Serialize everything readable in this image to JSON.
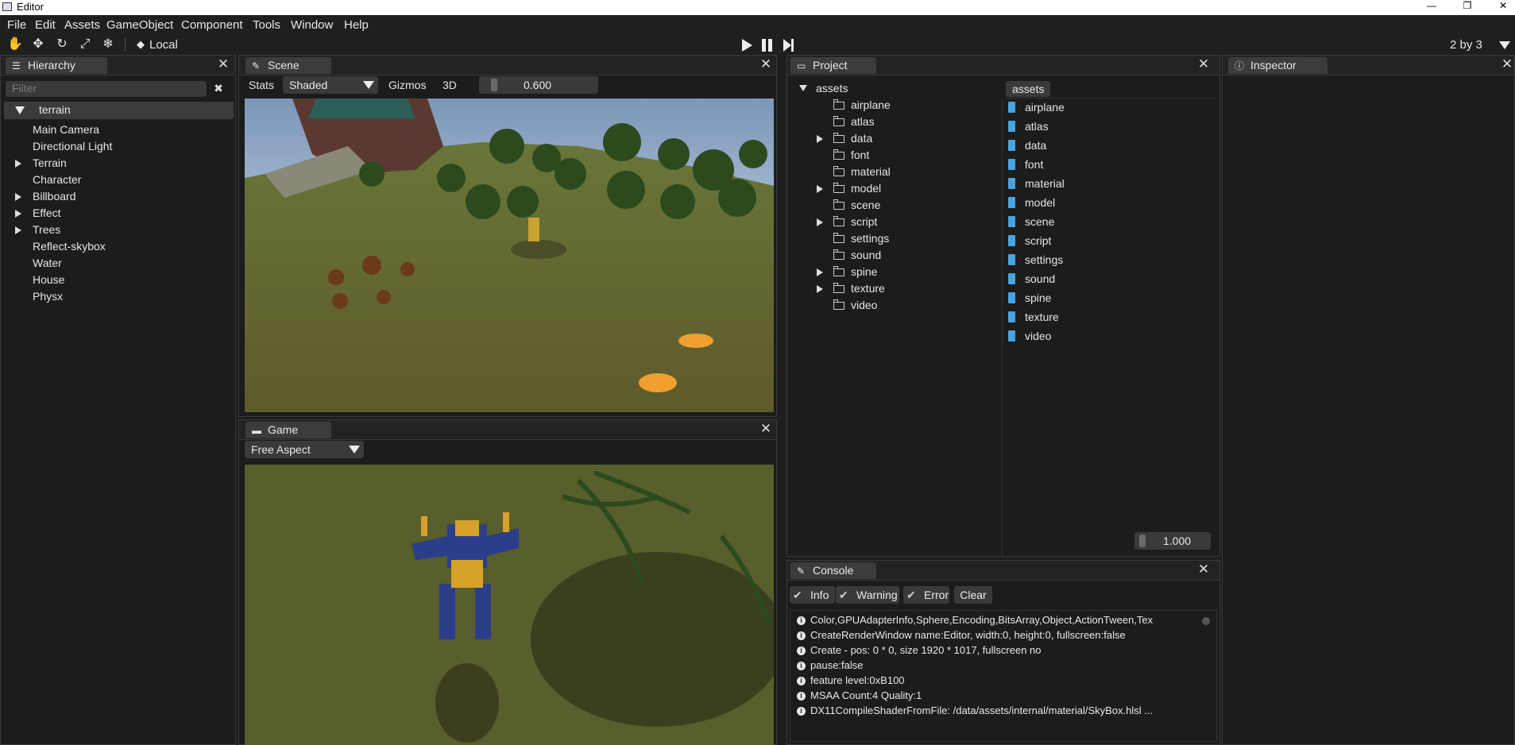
{
  "window": {
    "title": "Editor",
    "controls": [
      "—",
      "❐",
      "✕"
    ]
  },
  "menu": [
    "File",
    "Edit",
    "Assets",
    "GameObject",
    "Component",
    "Tools",
    "Window",
    "Help"
  ],
  "toolbar": {
    "space_label": "Local",
    "layout_label": "2 by 3"
  },
  "hierarchy": {
    "tab": "Hierarchy",
    "filter_placeholder": "Filter",
    "root": "terrain",
    "items": [
      {
        "label": "Main Camera",
        "expandable": false
      },
      {
        "label": "Directional Light",
        "expandable": false
      },
      {
        "label": "Terrain",
        "expandable": true
      },
      {
        "label": "Character",
        "expandable": false
      },
      {
        "label": "Billboard",
        "expandable": true
      },
      {
        "label": "Effect",
        "expandable": true
      },
      {
        "label": "Trees",
        "expandable": true
      },
      {
        "label": "Reflect-skybox",
        "expandable": false
      },
      {
        "label": "Water",
        "expandable": false
      },
      {
        "label": "House",
        "expandable": false
      },
      {
        "label": "Physx",
        "expandable": false
      }
    ]
  },
  "scene": {
    "tab": "Scene",
    "stats": "Stats",
    "shading": "Shaded",
    "gizmos": "Gizmos",
    "mode": "3D",
    "slider_value": "0.600"
  },
  "game": {
    "tab": "Game",
    "aspect": "Free Aspect"
  },
  "project": {
    "tab": "Project",
    "root": "assets",
    "breadcrumb": "assets",
    "tree": [
      {
        "label": "airplane",
        "expandable": false
      },
      {
        "label": "atlas",
        "expandable": false
      },
      {
        "label": "data",
        "expandable": true
      },
      {
        "label": "font",
        "expandable": false
      },
      {
        "label": "material",
        "expandable": false
      },
      {
        "label": "model",
        "expandable": true
      },
      {
        "label": "scene",
        "expandable": false
      },
      {
        "label": "script",
        "expandable": true
      },
      {
        "label": "settings",
        "expandable": false
      },
      {
        "label": "sound",
        "expandable": false
      },
      {
        "label": "spine",
        "expandable": true
      },
      {
        "label": "texture",
        "expandable": true
      },
      {
        "label": "video",
        "expandable": false
      }
    ],
    "files": [
      "airplane",
      "atlas",
      "data",
      "font",
      "material",
      "model",
      "scene",
      "script",
      "settings",
      "sound",
      "spine",
      "texture",
      "video"
    ],
    "zoom": "1.000"
  },
  "inspector": {
    "tab": "Inspector"
  },
  "console": {
    "tab": "Console",
    "filters": [
      "Info",
      "Warning",
      "Error"
    ],
    "clear": "Clear",
    "lines": [
      "Color,GPUAdapterInfo,Sphere,Encoding,BitsArray,Object,ActionTween,Tex",
      "CreateRenderWindow name:Editor, width:0, height:0, fullscreen:false",
      "Create - pos: 0 * 0, size 1920 * 1017, fullscreen no",
      "pause:false",
      "feature level:0xB100",
      "MSAA Count:4 Quality:1",
      "DX11CompileShaderFromFile: /data/assets/internal/material/SkyBox.hlsl ..."
    ]
  }
}
